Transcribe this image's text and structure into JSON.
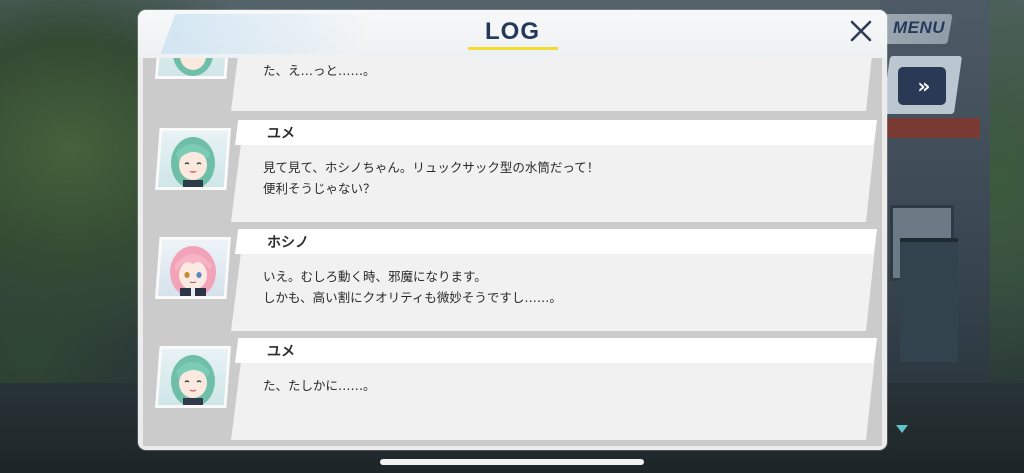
{
  "header": {
    "title": "LOG",
    "close_glyph": "✕",
    "accent_color": "#f2dc33",
    "title_color": "#24385a"
  },
  "hud": {
    "menu_label": "MENU",
    "skip_icon": "fast-forward-icon"
  },
  "log": {
    "entries": [
      {
        "speaker": "",
        "avatar": "yume",
        "lines": [
          "た、え…っと……。",
          ""
        ]
      },
      {
        "speaker": "ユメ",
        "avatar": "yume",
        "lines": [
          "見て見て、ホシノちゃん。リュックサック型の水筒だって！",
          "便利そうじゃない？"
        ]
      },
      {
        "speaker": "ホシノ",
        "avatar": "hoshino",
        "lines": [
          "いえ。むしろ動く時、邪魔になります。",
          "しかも、高い割にクオリティも微妙そうですし……。"
        ]
      },
      {
        "speaker": "ユメ",
        "avatar": "yume",
        "lines": [
          "た、たしかに……。",
          ""
        ]
      }
    ]
  },
  "colors": {
    "panel_bg": "#ececec",
    "log_area_bg": "#cbcbcb",
    "yume_hair": "#6fbfa8",
    "hoshino_hair": "#f2a3b8"
  }
}
